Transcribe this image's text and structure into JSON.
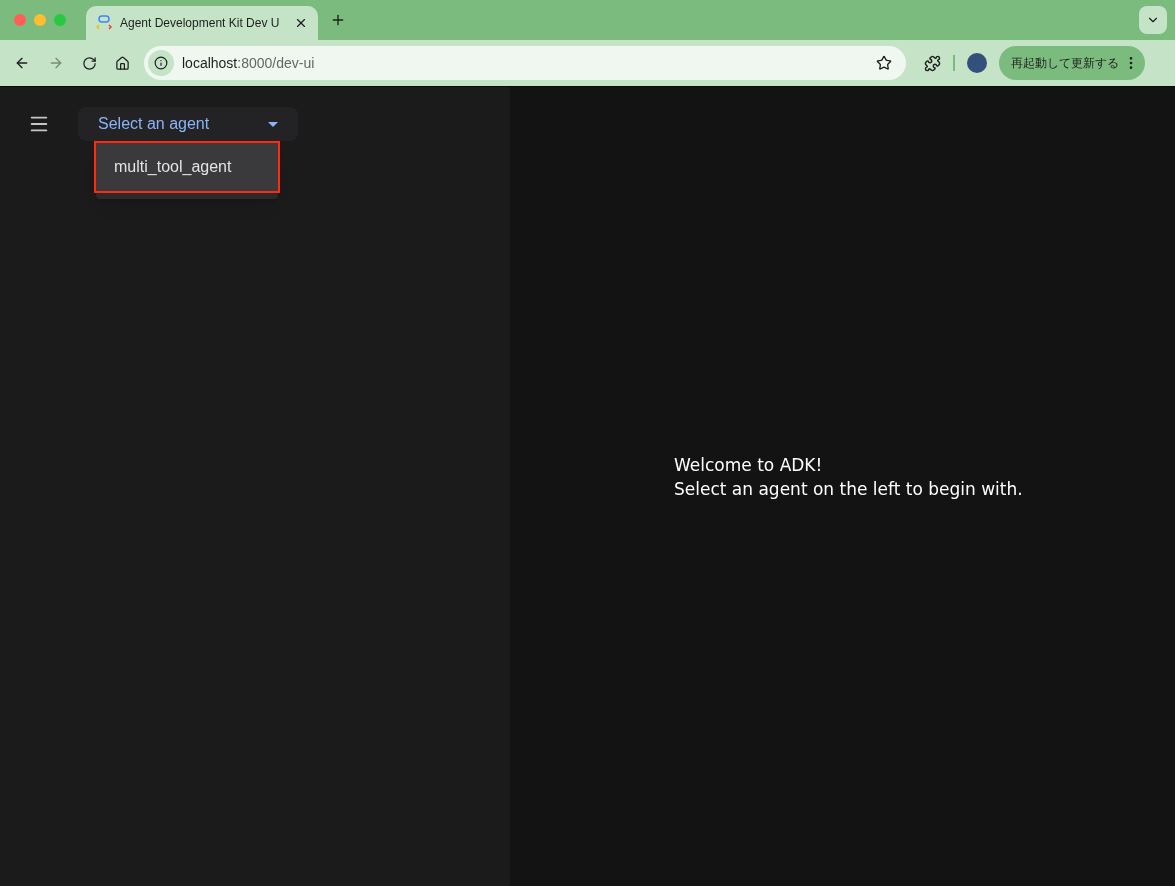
{
  "browser": {
    "tab": {
      "title": "Agent Development Kit Dev U",
      "selected": true
    },
    "address": {
      "host": "localhost",
      "path": ":8000/dev-ui"
    },
    "update_button": "再起動して更新する"
  },
  "sidebar": {
    "agent_select": {
      "placeholder": "Select an agent",
      "expanded": true
    },
    "options": [
      {
        "label": "multi_tool_agent",
        "highlighted": true
      }
    ]
  },
  "welcome": {
    "lines": [
      "Welcome to ADK!",
      "Select an agent on the left to begin with."
    ]
  }
}
